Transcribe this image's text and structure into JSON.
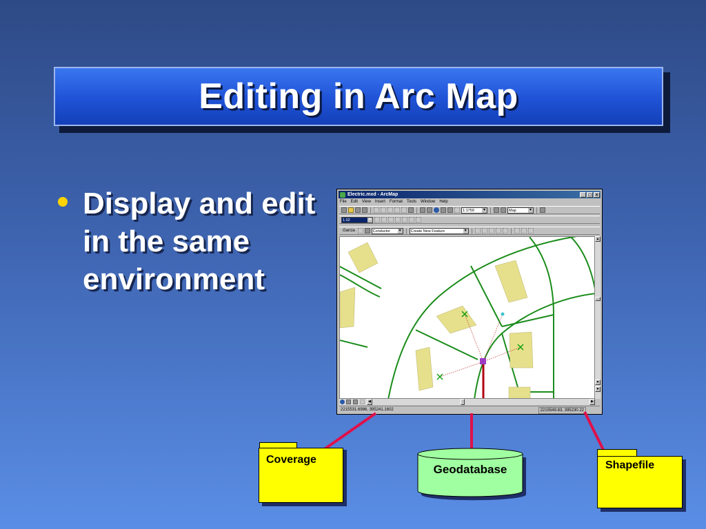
{
  "slide": {
    "title": "Editing in Arc Map",
    "bullet": "Display and edit in the same environment"
  },
  "window": {
    "title": "Electric.mxd - ArcMap",
    "menu": [
      "File",
      "Edit",
      "View",
      "Insert",
      "Format",
      "Tools",
      "Window",
      "Help"
    ],
    "scale_value": "1:1759",
    "layer_combo": "Map",
    "version_combo": "1.02",
    "editor_label": "Editor",
    "workspace_label": "Garcia",
    "target_combo": "Conductor",
    "task_combo": "Create New Feature",
    "status_left": "2215531.6986, 395241.1602",
    "status_right": "2215549.83, 395230.22"
  },
  "data_sources": {
    "coverage": "Coverage",
    "geodatabase": "Geodatabase",
    "shapefile": "Shapefile"
  },
  "colors": {
    "title_bg": "#1f52d6",
    "bullet_dot": "#ffd400",
    "folder_fill": "#ffff00",
    "cylinder_fill": "#a0ffa0",
    "connector": "#e0104a",
    "parcel_line": "#1a8c1a",
    "building_fill": "#e6e08c",
    "conductor": "#b00010",
    "node": "#9c3cc4"
  }
}
